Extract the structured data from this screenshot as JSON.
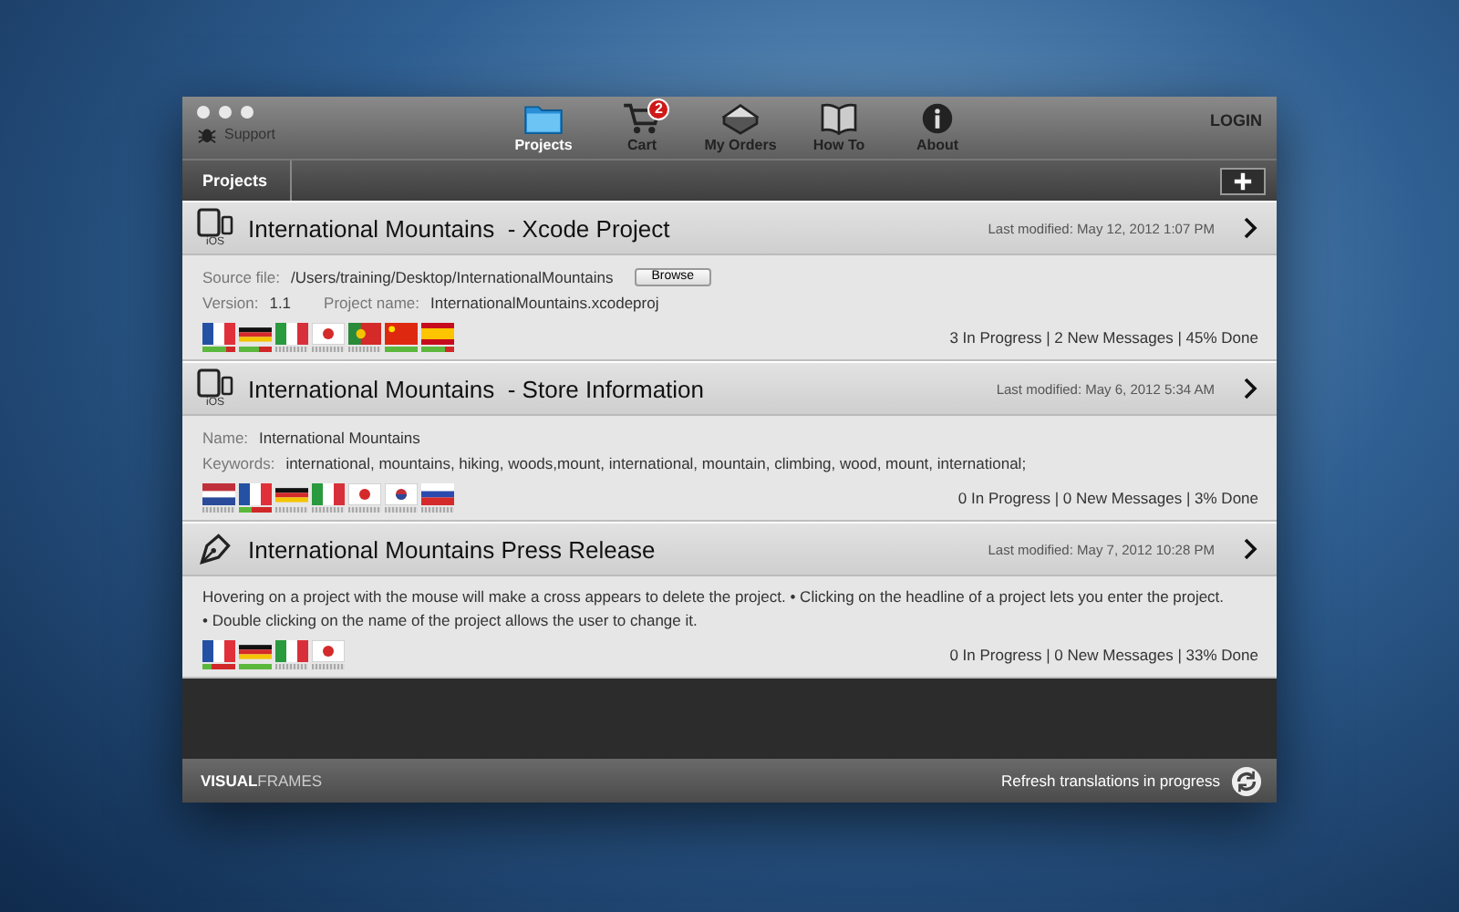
{
  "window": {
    "support_label": "Support",
    "login": "LOGIN"
  },
  "nav": [
    {
      "label": "Projects",
      "kind": "folder",
      "selected": true
    },
    {
      "label": "Cart",
      "kind": "cart",
      "selected": false,
      "badge": "2"
    },
    {
      "label": "My Orders",
      "kind": "orders",
      "selected": false
    },
    {
      "label": "How To",
      "kind": "book",
      "selected": false
    },
    {
      "label": "About",
      "kind": "info",
      "selected": false
    }
  ],
  "breadcrumb": "Projects",
  "projects": [
    {
      "kind": "ios",
      "platform": "iOS",
      "title": "International Mountains  - Xcode Project",
      "modified": "Last modified: May 12, 2012 1:07 PM",
      "fields": [
        [
          {
            "label": "Source file:",
            "value": "/Users/training/Desktop/InternationalMountains",
            "button": "Browse"
          }
        ],
        [
          {
            "label": "Version:",
            "value": "1.1"
          },
          {
            "label": "Project name:",
            "value": "InternationalMountains.xcodeproj"
          }
        ]
      ],
      "flags": [
        {
          "kind": "fr",
          "level": 0.7
        },
        {
          "kind": "de",
          "level": 0.6
        },
        {
          "kind": "it",
          "level": 0
        },
        {
          "kind": "jp",
          "level": 0
        },
        {
          "kind": "pt",
          "level": 0
        },
        {
          "kind": "cn",
          "level": 1
        },
        {
          "kind": "es",
          "level": 0.7
        }
      ],
      "summary": "3 In Progress | 2 New Messages | 45% Done"
    },
    {
      "kind": "ios",
      "platform": "iOS",
      "title": "International Mountains  - Store Information",
      "modified": "Last modified: May 6, 2012 5:34 AM",
      "fields": [
        [
          {
            "label": "Name:",
            "value": "International Mountains"
          }
        ],
        [
          {
            "label": "Keywords:",
            "value": "international, mountains, hiking, woods,mount, international, mountain, climbing, wood, mount, international;"
          }
        ]
      ],
      "flags": [
        {
          "kind": "nl",
          "level": 0
        },
        {
          "kind": "fr",
          "level": 0.4
        },
        {
          "kind": "de",
          "level": 0
        },
        {
          "kind": "it",
          "level": 0
        },
        {
          "kind": "jp",
          "level": 0
        },
        {
          "kind": "kr",
          "level": 0
        },
        {
          "kind": "ru",
          "level": 0
        }
      ],
      "summary": "0 In Progress | 0 New Messages | 3% Done"
    },
    {
      "kind": "press",
      "title": "International Mountains Press Release",
      "modified": "Last modified: May 7, 2012 10:28 PM",
      "text": "Hovering on a project with the mouse will make a cross appears to delete the project. • Clicking on the headline of a project lets you enter the project. • Double clicking on the name of the project allows the user to change it.",
      "flags": [
        {
          "kind": "fr",
          "level": 0.3
        },
        {
          "kind": "de",
          "level": 1
        },
        {
          "kind": "it",
          "level": 0
        },
        {
          "kind": "jp",
          "level": 0
        }
      ],
      "summary": "0 In Progress | 0 New Messages | 33% Done"
    }
  ],
  "footer": {
    "logo": "**VISUAL**FRAMES",
    "refresh": "Refresh translations in progress"
  }
}
